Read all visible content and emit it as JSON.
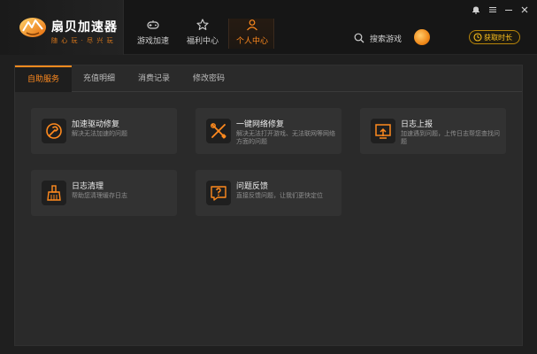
{
  "app": {
    "name": "扇贝加速器",
    "slogan": "随 心 玩 · 尽 兴 玩"
  },
  "nav": [
    {
      "label": "游戏加速",
      "icon": "gamepad-icon"
    },
    {
      "label": "福利中心",
      "icon": "star-icon"
    },
    {
      "label": "个人中心",
      "icon": "user-icon",
      "active": true
    }
  ],
  "search": {
    "label": "搜索游戏"
  },
  "header": {
    "get_time_label": "获取时长"
  },
  "tabs": [
    {
      "label": "自助服务",
      "active": true
    },
    {
      "label": "充值明细"
    },
    {
      "label": "消费记录"
    },
    {
      "label": "修改密码"
    }
  ],
  "services": [
    {
      "title": "加速驱动修复",
      "desc": "解决无法加速的问题",
      "icon": "repair-tool-icon"
    },
    {
      "title": "一键网络修复",
      "desc": "解决无法打开游戏、无法联网等网络方面的问题",
      "icon": "wrench-screwdriver-icon"
    },
    {
      "title": "日志上报",
      "desc": "加速遇到问题，上传日志帮您查找问题",
      "icon": "upload-log-icon"
    },
    {
      "title": "日志清理",
      "desc": "帮助您清理缓存日志",
      "icon": "broom-icon"
    },
    {
      "title": "问题反馈",
      "desc": "直接反馈问题，让我们更快定位",
      "icon": "question-feedback-icon"
    }
  ],
  "colors": {
    "accent": "#ff8a1e",
    "gold": "#ffc21e",
    "background": "#1f1f1f",
    "panel": "#2a2a2a",
    "card": "#323232"
  }
}
